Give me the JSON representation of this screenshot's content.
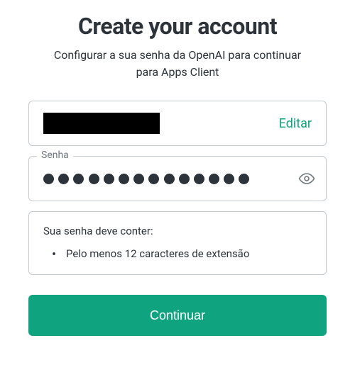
{
  "title": "Create your account",
  "subtitle": "Configurar a sua senha da OpenAI para continuar para Apps Client",
  "email_row": {
    "edit_label": "Editar"
  },
  "password": {
    "label": "Senha",
    "value_length": 14
  },
  "requirements": {
    "title": "Sua senha deve conter:",
    "items": [
      "Pelo menos 12 caracteres de extensão"
    ]
  },
  "continue_label": "Continuar",
  "colors": {
    "accent": "#10a37f",
    "border": "#c2c8d0",
    "text": "#2d333a"
  }
}
